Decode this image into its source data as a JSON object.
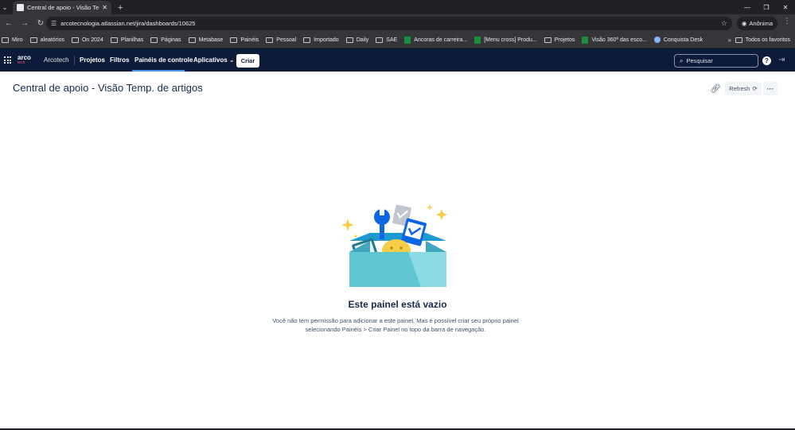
{
  "browser": {
    "tab_title": "Central de apoio - Visão Temp.",
    "url": "arcotecnologia.atlassian.net/jira/dashboards/10625",
    "incognito_label": "Anônima",
    "bookmarks": [
      {
        "label": "Miro",
        "icon": "folder-icon"
      },
      {
        "label": "aleatórios",
        "icon": "folder-icon"
      },
      {
        "label": "On 2024",
        "icon": "folder-icon"
      },
      {
        "label": "Planilhas",
        "icon": "folder-icon"
      },
      {
        "label": "Páginas",
        "icon": "folder-icon"
      },
      {
        "label": "Metabase",
        "icon": "folder-icon"
      },
      {
        "label": "Painéis",
        "icon": "folder-icon"
      },
      {
        "label": "Pessoal",
        "icon": "folder-icon"
      },
      {
        "label": "Importado",
        "icon": "folder-icon"
      },
      {
        "label": "Daily",
        "icon": "folder-icon"
      },
      {
        "label": "SAE",
        "icon": "folder-icon"
      },
      {
        "label": "Ancoras de carreira...",
        "icon": "sheets-icon"
      },
      {
        "label": "[Menu cross] Produ...",
        "icon": "sheets-icon"
      },
      {
        "label": "Projetos",
        "icon": "folder-icon"
      },
      {
        "label": "Visão 360º das esco...",
        "icon": "sheets-icon"
      },
      {
        "label": "Conquista Desk",
        "icon": "desk-icon"
      }
    ],
    "all_bookmarks_label": "Todos os favoritos"
  },
  "appbar": {
    "logo_top": "arco",
    "logo_bottom": "tech",
    "site_name": "Arcotech",
    "nav": {
      "projects": "Projetos",
      "filters": "Filtros",
      "dashboards": "Painéis de controle",
      "apps": "Aplicativos"
    },
    "create_label": "Criar",
    "search_placeholder": "Pesquisar"
  },
  "dashboard": {
    "title": "Central de apoio - Visão Temp. de artigos",
    "refresh_label": "Refresh",
    "empty_title": "Este painel está vazio",
    "empty_description": "Você não tem permissão para adicionar a este painel. Mas é possível criar seu próprio painel selecionando Painéis > Criar Painel no topo da barra de navegação."
  },
  "colors": {
    "appbar_bg": "#0b1b39",
    "active_tab_indicator": "#4c9aff",
    "title_text": "#172b4d",
    "body_text": "#42526e"
  }
}
